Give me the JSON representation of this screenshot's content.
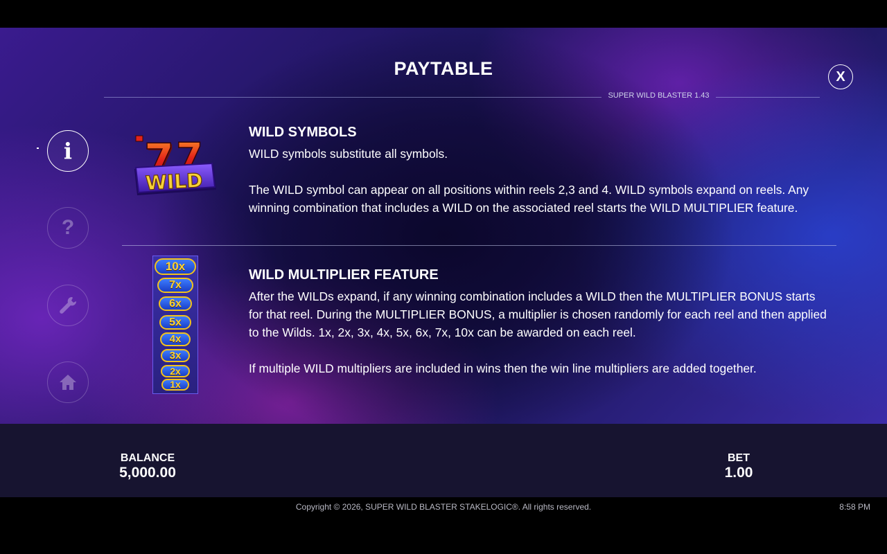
{
  "header": {
    "title": "PAYTABLE",
    "version": "SUPER WILD BLASTER 1.43",
    "close_label": "X"
  },
  "nav": [
    {
      "name": "info-icon",
      "glyph": "i",
      "active": true
    },
    {
      "name": "help-icon",
      "glyph": "?",
      "active": false
    },
    {
      "name": "settings-wrench-icon",
      "active": false
    },
    {
      "name": "home-icon",
      "active": false
    }
  ],
  "sections": {
    "wild": {
      "title": "WILD SYMBOLS",
      "p1": "WILD symbols substitute all symbols.",
      "p2": "The WILD symbol can appear on all positions within reels 2,3 and 4. WILD symbols expand on reels. Any winning combination that includes a WILD on the associated reel starts the WILD MULTIPLIER feature.",
      "symbol": {
        "digit": "7",
        "label": "WILD"
      }
    },
    "multiplier": {
      "title": "WILD MULTIPLIER FEATURE",
      "p1": "After the WILDs expand, if any winning combination includes a WILD then the MULTIPLIER BONUS starts for that reel. During the MULTIPLIER BONUS, a multiplier is chosen randomly for each reel and then applied to the Wilds. 1x, 2x, 3x, 4x, 5x, 6x, 7x, 10x can be awarded on each reel.",
      "p2": "If multiple WILD multipliers are included in wins then the win line multipliers are added together.",
      "multipliers": [
        "10x",
        "7x",
        "6x",
        "5x",
        "4x",
        "3x",
        "2x",
        "1x"
      ]
    }
  },
  "bottom": {
    "balance_label": "BALANCE",
    "balance_value": "5,000.00",
    "bet_label": "BET",
    "bet_value": "1.00"
  },
  "footer": {
    "copyright": "Copyright © 2026, SUPER WILD BLASTER STAKELOGIC®. All rights reserved.",
    "time": "8:58 PM"
  },
  "colors": {
    "accent_gold": "#f3c21b",
    "wild_red": "#e2231a",
    "wild_purple": "#5a2bd0",
    "bottom_bar": "#171430"
  }
}
